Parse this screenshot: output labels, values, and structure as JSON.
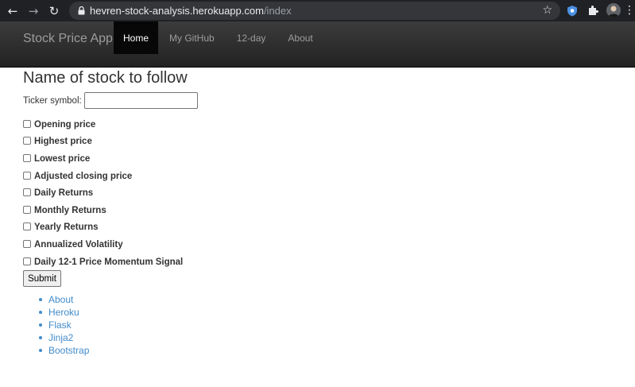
{
  "browser": {
    "url_host": "hevren-stock-analysis.herokuapp.com",
    "url_path": "/index",
    "icons": {
      "back": "arrow-left-icon",
      "forward": "arrow-right-icon",
      "reload": "reload-icon",
      "lock": "lock-icon",
      "bookmark": "star-icon",
      "extension": "puzzle-icon",
      "menu": "kebab-menu-icon"
    }
  },
  "navbar": {
    "brand": "Stock Price App",
    "items": [
      {
        "label": "Home",
        "active": true
      },
      {
        "label": "My GitHub",
        "active": false
      },
      {
        "label": "12-day",
        "active": false
      },
      {
        "label": "About",
        "active": false
      }
    ]
  },
  "form": {
    "heading": "Name of stock to follow",
    "ticker_label": "Ticker symbol:",
    "ticker_value": "",
    "options": [
      "Opening price",
      "Highest price",
      "Lowest price",
      "Adjusted closing price",
      "Daily Returns",
      "Monthly Returns",
      "Yearly Returns",
      "Annualized Volatility",
      "Daily 12-1 Price Momentum Signal"
    ],
    "submit_label": "Submit"
  },
  "links": [
    "About",
    "Heroku",
    "Flask",
    "Jinja2",
    "Bootstrap"
  ],
  "colors": {
    "navbar_bg": "#222222",
    "nav_active_bg": "#080808",
    "link": "#428bca",
    "chrome_bg": "#202124"
  }
}
